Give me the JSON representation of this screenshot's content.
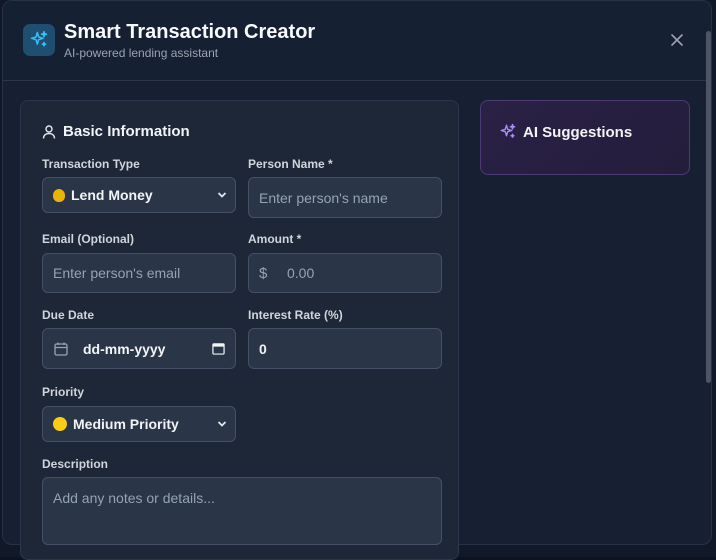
{
  "header": {
    "title": "Smart Transaction Creator",
    "subtitle": "AI-powered lending assistant"
  },
  "basic_info": {
    "section_title": "Basic Information",
    "transaction_type": {
      "label": "Transaction Type",
      "value": "Lend Money",
      "icon": "money-bag-icon"
    },
    "person_name": {
      "label": "Person Name *",
      "placeholder": "Enter person's name"
    },
    "email": {
      "label": "Email (Optional)",
      "placeholder": "Enter person's email"
    },
    "amount": {
      "label": "Amount *",
      "placeholder": "0.00",
      "currency": "$"
    },
    "due_date": {
      "label": "Due Date",
      "placeholder": "dd-mm-yyyy"
    },
    "interest_rate": {
      "label": "Interest Rate (%)",
      "value": "0"
    },
    "priority": {
      "label": "Priority",
      "value": "Medium Priority",
      "color": "#facc15"
    },
    "description": {
      "label": "Description",
      "placeholder": "Add any notes or details..."
    }
  },
  "ai_suggestions": {
    "title": "AI Suggestions"
  },
  "colors": {
    "accent": "#38bdf8",
    "ai_accent": "#a78bfa"
  }
}
